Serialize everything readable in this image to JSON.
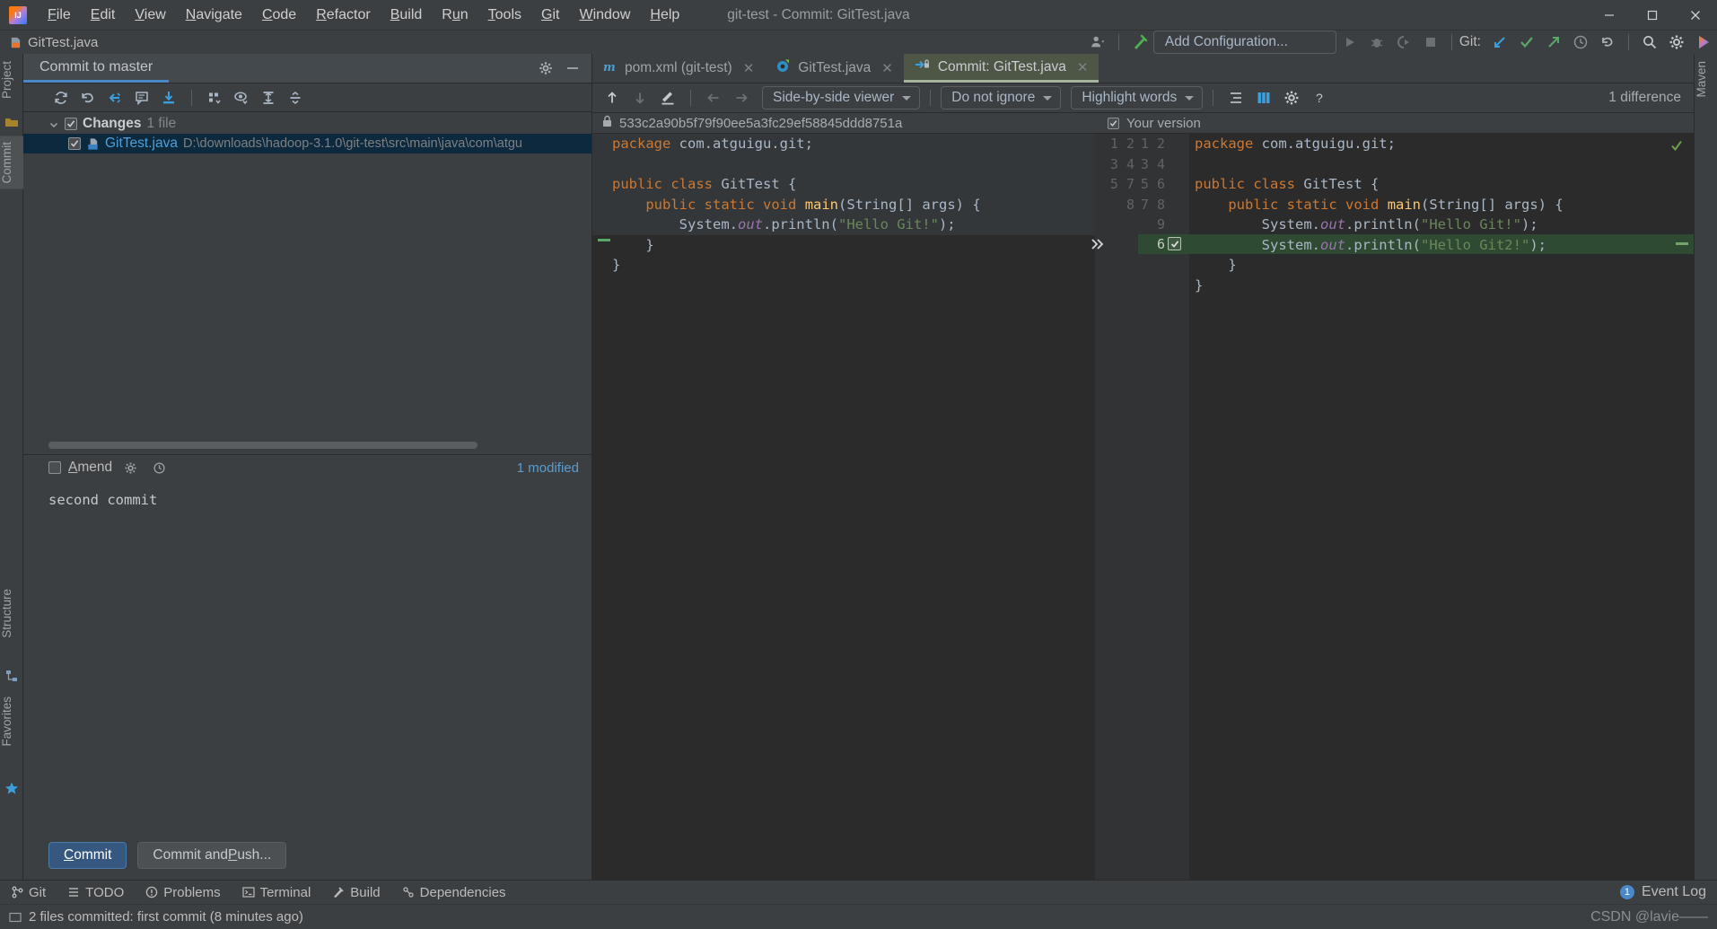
{
  "window": {
    "title": "git-test - Commit: GitTest.java",
    "logo_icon": "intellij-idea-logo",
    "minimize_icon": "minimize-icon",
    "maximize_icon": "maximize-icon",
    "close_icon": "close-icon"
  },
  "menu": [
    {
      "label": "File",
      "mnemonic": "F"
    },
    {
      "label": "Edit",
      "mnemonic": "E"
    },
    {
      "label": "View",
      "mnemonic": "V"
    },
    {
      "label": "Navigate",
      "mnemonic": "N"
    },
    {
      "label": "Code",
      "mnemonic": "C"
    },
    {
      "label": "Refactor",
      "mnemonic": "R"
    },
    {
      "label": "Build",
      "mnemonic": "B"
    },
    {
      "label": "Run",
      "mnemonic": "R"
    },
    {
      "label": "Tools",
      "mnemonic": "T"
    },
    {
      "label": "Git",
      "mnemonic": "G"
    },
    {
      "label": "Window",
      "mnemonic": "W"
    },
    {
      "label": "Help",
      "mnemonic": "H"
    }
  ],
  "navbar": {
    "crumb": "GitTest.java",
    "crumb_icon": "java-class-icon"
  },
  "toolbar": {
    "add_configuration": "Add Configuration...",
    "git_label": "Git:",
    "icons": [
      "user-settings-icon",
      "hammer-build-icon",
      "run-icon",
      "debug-icon",
      "run-with-coverage-icon",
      "stop-icon",
      "git-update-icon",
      "git-commit-check-icon",
      "git-push-icon",
      "git-history-icon",
      "git-rollback-icon",
      "search-everywhere-icon",
      "settings-gear-icon",
      "ide-feedback-icon"
    ]
  },
  "left_stripe": [
    {
      "label": "Project",
      "icon": "project-icon"
    },
    {
      "label": "Commit",
      "icon": "commit-icon",
      "active": true
    },
    {
      "label": "Structure",
      "icon": "structure-icon"
    },
    {
      "label": "Favorites",
      "icon": "favorites-star-icon"
    }
  ],
  "right_stripe": [
    {
      "label": "Maven",
      "icon": "maven-icon"
    }
  ],
  "commit_panel": {
    "tab_title": "Commit to master",
    "tab_icons": [
      "settings-gear-icon",
      "hide-minimize-icon"
    ],
    "toolbar_icons": [
      "refresh-changes-icon",
      "rollback-icon",
      "show-diff-icon",
      "group-by-icon",
      "shelve-silently-icon",
      "group-settings-icon",
      "preview-diff-icon",
      "expand-all-icon",
      "collapse-all-icon"
    ],
    "tree": {
      "group_label": "Changes",
      "group_count": "1 file",
      "group_checked": true,
      "expanded": true,
      "files": [
        {
          "name": "GitTest.java",
          "path": "D:\\downloads\\hadoop-3.1.0\\git-test\\src\\main\\java\\com\\atgu",
          "checked": true,
          "selected": true,
          "icon": "java-file-icon"
        }
      ]
    },
    "amend_label": "Amend",
    "amend_mnemonic": "A",
    "amend_checked": false,
    "amend_icons": [
      "commit-options-gear-icon",
      "commit-history-clock-icon"
    ],
    "modified_status": "1 modified",
    "commit_message": "second commit",
    "buttons": [
      {
        "label": "Commit",
        "primary": true,
        "mnemonic": "C"
      },
      {
        "label": "Commit and Push...",
        "primary": false,
        "mnemonic": "P"
      }
    ]
  },
  "editor_tabs": [
    {
      "label": "pom.xml (git-test)",
      "icon": "maven-m-icon",
      "active": false,
      "close_icon": "close-icon"
    },
    {
      "label": "GitTest.java",
      "icon": "java-class-green-icon",
      "active": false,
      "close_icon": "close-icon"
    },
    {
      "label": "Commit: GitTest.java",
      "icon": "diff-commit-icon",
      "active": true,
      "close_icon": "close-icon"
    }
  ],
  "diff_toolbar": {
    "icons": [
      "previous-difference-icon",
      "next-difference-icon",
      "edit-source-icon",
      "previous-change-arrow-icon",
      "next-change-arrow-icon"
    ],
    "viewer_mode": "Side-by-side viewer",
    "whitespace_mode": "Do not ignore",
    "highlight_mode": "Highlight words",
    "trailing_icons": [
      "collapse-unchanged-icon",
      "show-diff-panels-icon",
      "diff-settings-gear-icon",
      "help-icon"
    ],
    "difference_count": "1 difference"
  },
  "diff_headers": {
    "left_title": "533c2a90b5f79f90ee5a3fc29ef58845ddd8751a",
    "left_icon": "lock-icon",
    "right_title": "Your version",
    "right_checked": true,
    "accept_icon": "accept-change-check-icon"
  },
  "diff": {
    "left_lines": [
      {
        "num": "",
        "text": "package com.atguigu.git;"
      },
      {
        "num": "",
        "text": ""
      },
      {
        "num": "",
        "text": "public class GitTest {"
      },
      {
        "num": "",
        "text": "    public static void main(String[] args) {"
      },
      {
        "num": "",
        "text": "        System.out.println(\"Hello Git!\");"
      },
      {
        "num": "",
        "text": "    }"
      },
      {
        "num": "",
        "text": "}"
      }
    ],
    "left_numbers": [
      "1",
      "2",
      "3",
      "4",
      "5",
      "",
      "7",
      "8"
    ],
    "right_numbers": [
      "1",
      "2",
      "3",
      "4",
      "5",
      "6",
      "7",
      "8",
      "9"
    ],
    "right_lines": [
      {
        "num": "1",
        "text": "package com.atguigu.git;"
      },
      {
        "num": "2",
        "text": ""
      },
      {
        "num": "3",
        "text": "public class GitTest {"
      },
      {
        "num": "4",
        "text": "    public static void main(String[] args) {"
      },
      {
        "num": "5",
        "text": "        System.out.println(\"Hello Git!\");"
      },
      {
        "num": "6",
        "text": "        System.out.println(\"Hello Git2!\");",
        "added": true
      },
      {
        "num": "7",
        "text": "    }"
      },
      {
        "num": "8",
        "text": "}"
      },
      {
        "num": "9",
        "text": ""
      }
    ],
    "added_line_number": "6",
    "added_marker_icon": "chevron-double-right-icon"
  },
  "bottom_tools": [
    {
      "label": "Git",
      "icon": "git-branch-icon"
    },
    {
      "label": "TODO",
      "icon": "todo-list-icon"
    },
    {
      "label": "Problems",
      "icon": "problems-icon"
    },
    {
      "label": "Terminal",
      "icon": "terminal-icon"
    },
    {
      "label": "Build",
      "icon": "build-hammer-icon"
    },
    {
      "label": "Dependencies",
      "icon": "dependencies-icon"
    }
  ],
  "event_log": {
    "label": "Event Log",
    "count": "1"
  },
  "statusbar": {
    "message": "2 files committed: first commit (8 minutes ago)",
    "icon": "status-info-icon",
    "watermark": "CSDN @lavie——"
  },
  "colors": {
    "accent_blue": "#4a88c7",
    "link_blue": "#4f9fd8",
    "added_green": "#2f4a32",
    "added_green_inner": "#3a6b3f",
    "keyword_orange": "#cc7832",
    "string_green": "#6a8759",
    "field_purple": "#9876aa",
    "method_yellow": "#ffc66d",
    "bg_panel": "#3c3f41",
    "bg_editor": "#2b2b2b",
    "tab_active_green": "#4e5746"
  }
}
